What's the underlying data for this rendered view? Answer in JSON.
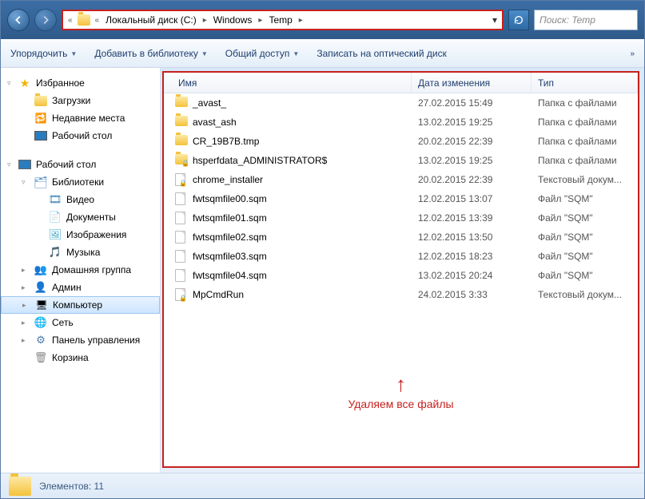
{
  "breadcrumb": {
    "parts": [
      "Локальный диск (C:)",
      "Windows",
      "Temp"
    ]
  },
  "search": {
    "placeholder": "Поиск: Temp"
  },
  "toolbar": {
    "organize": "Упорядочить",
    "add_library": "Добавить в библиотеку",
    "share": "Общий доступ",
    "burn": "Записать на оптический диск"
  },
  "sidebar": {
    "favorites": "Избранное",
    "downloads": "Загрузки",
    "recent": "Недавние места",
    "desktop_fav": "Рабочий стол",
    "desktop": "Рабочий стол",
    "libraries": "Библиотеки",
    "video": "Видео",
    "documents": "Документы",
    "pictures": "Изображения",
    "music": "Музыка",
    "homegroup": "Домашняя группа",
    "admin": "Админ",
    "computer": "Компьютер",
    "network": "Сеть",
    "control_panel": "Панель управления",
    "recycle_bin": "Корзина"
  },
  "columns": {
    "name": "Имя",
    "date": "Дата изменения",
    "type": "Тип"
  },
  "files": [
    {
      "icon": "folder",
      "name": "_avast_",
      "date": "27.02.2015 15:49",
      "type": "Папка с файлами"
    },
    {
      "icon": "folder",
      "name": "avast_ash",
      "date": "13.02.2015 19:25",
      "type": "Папка с файлами"
    },
    {
      "icon": "folder",
      "name": "CR_19B7B.tmp",
      "date": "20.02.2015 22:39",
      "type": "Папка с файлами"
    },
    {
      "icon": "folder-locked",
      "name": "hsperfdata_ADMINISTRATOR$",
      "date": "13.02.2015 19:25",
      "type": "Папка с файлами"
    },
    {
      "icon": "file-locked",
      "name": "chrome_installer",
      "date": "20.02.2015 22:39",
      "type": "Текстовый докум..."
    },
    {
      "icon": "file",
      "name": "fwtsqmfile00.sqm",
      "date": "12.02.2015 13:07",
      "type": "Файл \"SQM\""
    },
    {
      "icon": "file",
      "name": "fwtsqmfile01.sqm",
      "date": "12.02.2015 13:39",
      "type": "Файл \"SQM\""
    },
    {
      "icon": "file",
      "name": "fwtsqmfile02.sqm",
      "date": "12.02.2015 13:50",
      "type": "Файл \"SQM\""
    },
    {
      "icon": "file",
      "name": "fwtsqmfile03.sqm",
      "date": "12.02.2015 18:23",
      "type": "Файл \"SQM\""
    },
    {
      "icon": "file",
      "name": "fwtsqmfile04.sqm",
      "date": "13.02.2015 20:24",
      "type": "Файл \"SQM\""
    },
    {
      "icon": "file-locked",
      "name": "MpCmdRun",
      "date": "24.02.2015 3:33",
      "type": "Текстовый докум..."
    }
  ],
  "annotation": "Удаляем все файлы",
  "status": {
    "label": "Элементов:",
    "count": "11"
  }
}
